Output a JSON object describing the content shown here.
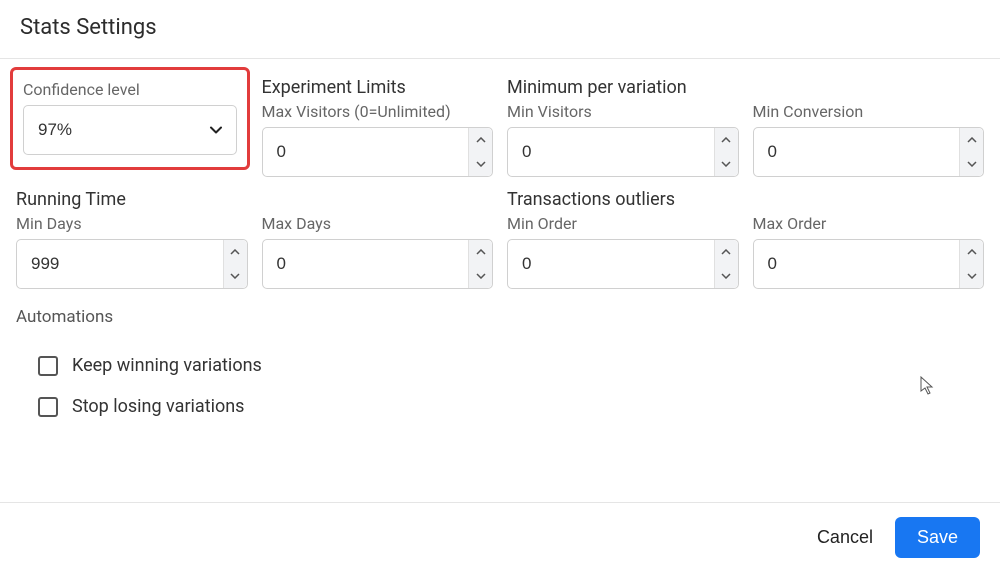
{
  "title": "Stats Settings",
  "sections": {
    "confidence": {
      "label": "Confidence level",
      "value": "97%"
    },
    "experiment_limits": {
      "heading": "Experiment Limits",
      "max_visitors_label": "Max Visitors (0=Unlimited)",
      "max_visitors_value": "0"
    },
    "minimum_per_variation": {
      "heading": "Minimum per variation",
      "min_visitors_label": "Min Visitors",
      "min_visitors_value": "0",
      "min_conversion_label": "Min Conversion",
      "min_conversion_value": "0"
    },
    "running_time": {
      "heading": "Running Time",
      "min_days_label": "Min Days",
      "min_days_value": "999",
      "max_days_label": "Max Days",
      "max_days_value": "0"
    },
    "transactions_outliers": {
      "heading": "Transactions outliers",
      "min_order_label": "Min Order",
      "min_order_value": "0",
      "max_order_label": "Max Order",
      "max_order_value": "0"
    }
  },
  "automations": {
    "heading": "Automations",
    "keep_winning_label": "Keep winning variations",
    "stop_losing_label": "Stop losing variations"
  },
  "footer": {
    "cancel": "Cancel",
    "save": "Save"
  }
}
